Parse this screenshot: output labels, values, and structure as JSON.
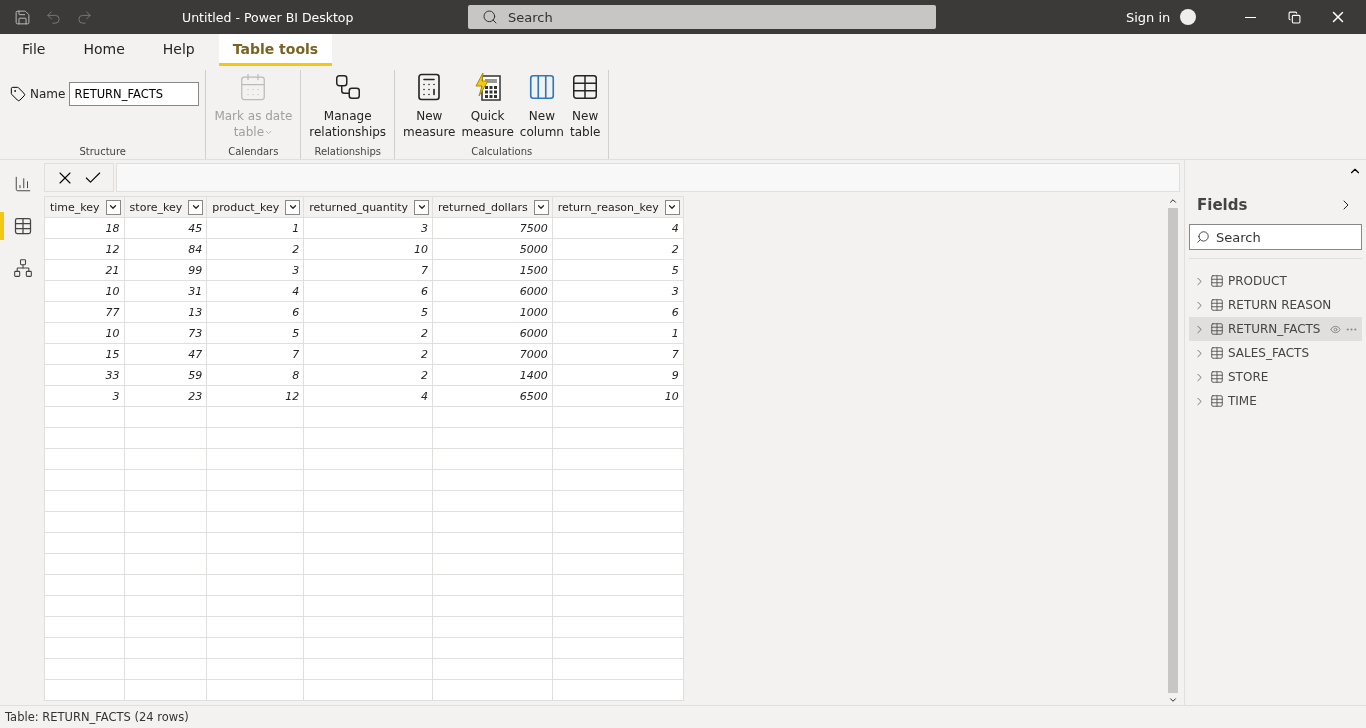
{
  "window": {
    "title": "Untitled - Power BI Desktop",
    "search_placeholder": "Search",
    "sign_in": "Sign in"
  },
  "menu_tabs": [
    {
      "label": "File",
      "selected": false
    },
    {
      "label": "Home",
      "selected": false
    },
    {
      "label": "Help",
      "selected": false
    },
    {
      "label": "Table tools",
      "selected": true
    }
  ],
  "ribbon": {
    "name_label": "Name",
    "name_value": "RETURN_FACTS",
    "groups": [
      {
        "label": "Structure"
      },
      {
        "label": "Calendars",
        "buttons": [
          {
            "lines": [
              "Mark as date",
              "table"
            ],
            "disabled": true,
            "dropdown": true
          }
        ]
      },
      {
        "label": "Relationships",
        "buttons": [
          {
            "lines": [
              "Manage",
              "relationships"
            ],
            "disabled": false,
            "dropdown": false
          }
        ]
      },
      {
        "label": "Calculations",
        "buttons": [
          {
            "lines": [
              "New",
              "measure"
            ],
            "disabled": false,
            "dropdown": false
          },
          {
            "lines": [
              "Quick",
              "measure"
            ],
            "disabled": false,
            "dropdown": false
          },
          {
            "lines": [
              "New",
              "column"
            ],
            "disabled": false,
            "dropdown": false
          },
          {
            "lines": [
              "New",
              "table"
            ],
            "disabled": false,
            "dropdown": false
          }
        ]
      }
    ]
  },
  "nav": [
    {
      "selected": false
    },
    {
      "selected": true
    },
    {
      "selected": false
    }
  ],
  "table": {
    "columns": [
      "time_key",
      "store_key",
      "product_key",
      "returned_quantity",
      "returned_dollars",
      "return_reason_key"
    ],
    "rows": [
      [
        "18",
        "45",
        "1",
        "3",
        "7500",
        "4"
      ],
      [
        "12",
        "84",
        "2",
        "10",
        "5000",
        "2"
      ],
      [
        "21",
        "99",
        "3",
        "7",
        "1500",
        "5"
      ],
      [
        "10",
        "31",
        "4",
        "6",
        "6000",
        "3"
      ],
      [
        "77",
        "13",
        "6",
        "5",
        "1000",
        "6"
      ],
      [
        "10",
        "73",
        "5",
        "2",
        "6000",
        "1"
      ],
      [
        "15",
        "47",
        "7",
        "2",
        "7000",
        "7"
      ],
      [
        "33",
        "59",
        "8",
        "2",
        "1400",
        "9"
      ],
      [
        "3",
        "23",
        "12",
        "4",
        "6500",
        "10"
      ]
    ]
  },
  "fields": {
    "title": "Fields",
    "search_placeholder": "Search",
    "items": [
      {
        "label": "PRODUCT",
        "selected": false
      },
      {
        "label": "RETURN REASON",
        "selected": false
      },
      {
        "label": "RETURN_FACTS",
        "selected": true
      },
      {
        "label": "SALES_FACTS",
        "selected": false
      },
      {
        "label": "STORE",
        "selected": false
      },
      {
        "label": "TIME",
        "selected": false
      }
    ]
  },
  "status_bar": "Table: RETURN_FACTS (24 rows)"
}
